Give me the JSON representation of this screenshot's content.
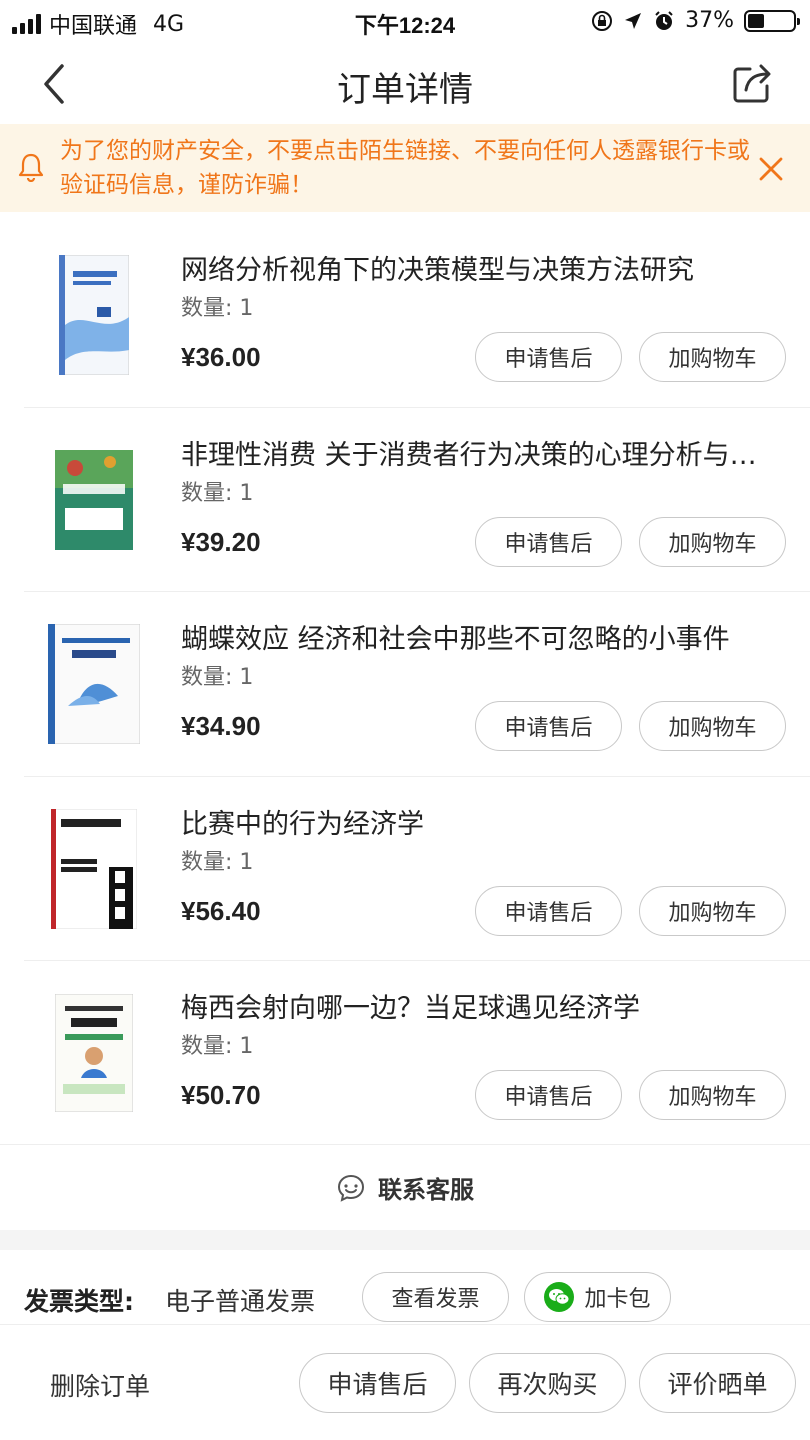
{
  "status_bar": {
    "carrier": "中国联通",
    "network": "4G",
    "time": "下午12:24",
    "battery": "37%",
    "battery_level": 0.37
  },
  "nav": {
    "title": "订单详情"
  },
  "notice": {
    "text": "为了您的财产安全，不要点击陌生链接、不要向任何人透露银行卡或验证码信息，谨防诈骗！"
  },
  "items": [
    {
      "name": "网络分析视角下的决策模型与决策方法研究",
      "qty": "数量: 1",
      "price": "¥36.00",
      "cover_title": "网络分析视角下的决策模型与决策方法研究",
      "aftersale": "申请售后",
      "cart": "加购物车"
    },
    {
      "name": "非理性消费 关于消费者行为决策的心理分析与研究",
      "qty": "数量: 1",
      "price": "¥39.20",
      "cover_title": "非理性消费",
      "aftersale": "申请售后",
      "cart": "加购物车"
    },
    {
      "name": "蝴蝶效应  经济和社会中那些不可忽略的小事件",
      "qty": "数量: 1",
      "price": "¥34.90",
      "cover_title": "Butterfly Economics 蝴蝶效应",
      "aftersale": "申请售后",
      "cart": "加购物车"
    },
    {
      "name": "比赛中的行为经济学",
      "qty": "数量: 1",
      "price": "¥56.40",
      "cover_title": "Scorecasting 比赛中的行为经济学",
      "aftersale": "申请售后",
      "cart": "加购物车"
    },
    {
      "name": "梅西会射向哪一边？当足球遇见经济学",
      "qty": "数量: 1",
      "price": "¥50.70",
      "cover_title": "梅西会射向哪一边？",
      "aftersale": "申请售后",
      "cart": "加购物车"
    }
  ],
  "contact": {
    "label": "联系客服"
  },
  "invoice": {
    "label": "发票类型:",
    "value": "电子普通发票",
    "view_button": "查看发票",
    "wallet_button": "加卡包"
  },
  "bottom_bar": {
    "delete": "删除订单",
    "aftersale": "申请售后",
    "rebuy": "再次购买",
    "review": "评价晒单"
  }
}
